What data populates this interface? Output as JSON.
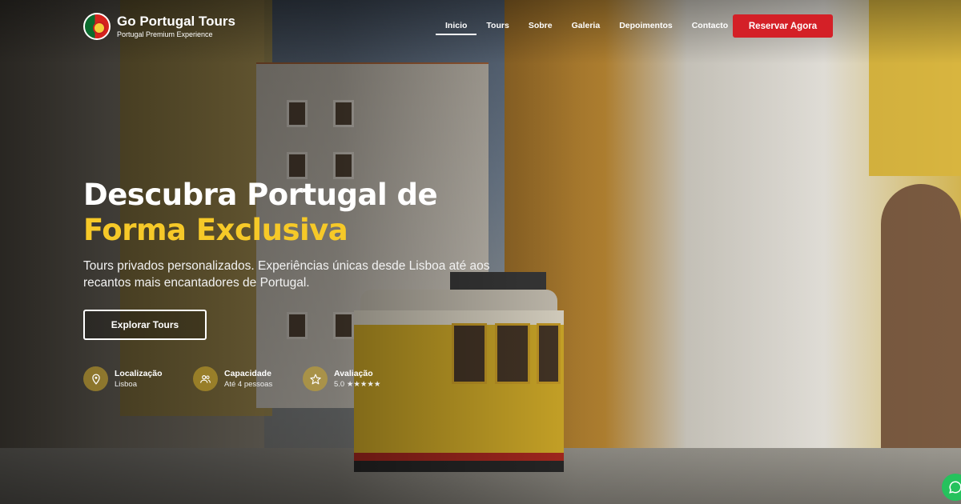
{
  "brand": {
    "name": "Go Portugal Tours",
    "tagline": "Portugal Premium Experience",
    "logo_icon": "portugal-flag-logo"
  },
  "nav": {
    "items": [
      {
        "label": "Inicio",
        "active": true
      },
      {
        "label": "Tours",
        "active": false
      },
      {
        "label": "Sobre",
        "active": false
      },
      {
        "label": "Galeria",
        "active": false
      },
      {
        "label": "Depoimentos",
        "active": false
      },
      {
        "label": "Contacto",
        "active": false
      }
    ],
    "cta_label": "Reservar Agora"
  },
  "hero": {
    "title_line1": "Descubra Portugal de",
    "title_line2": "Forma Exclusiva",
    "subtitle": "Tours privados personalizados. Experiências únicas desde Lisboa até aos recantos mais encantadores de Portugal.",
    "button_label": "Explorar Tours"
  },
  "features": [
    {
      "label": "Localização",
      "value": "Lisboa",
      "icon": "location-pin-icon"
    },
    {
      "label": "Capacidade",
      "value": "Até 4 pessoas",
      "icon": "users-icon"
    },
    {
      "label": "Avaliação",
      "value": "5.0 ★★★★★",
      "icon": "star-icon"
    }
  ],
  "colors": {
    "accent_yellow": "#f6c928",
    "cta_red": "#d42027",
    "chat_green": "#25c25d"
  },
  "chat_icon": "whatsapp-chat-icon"
}
